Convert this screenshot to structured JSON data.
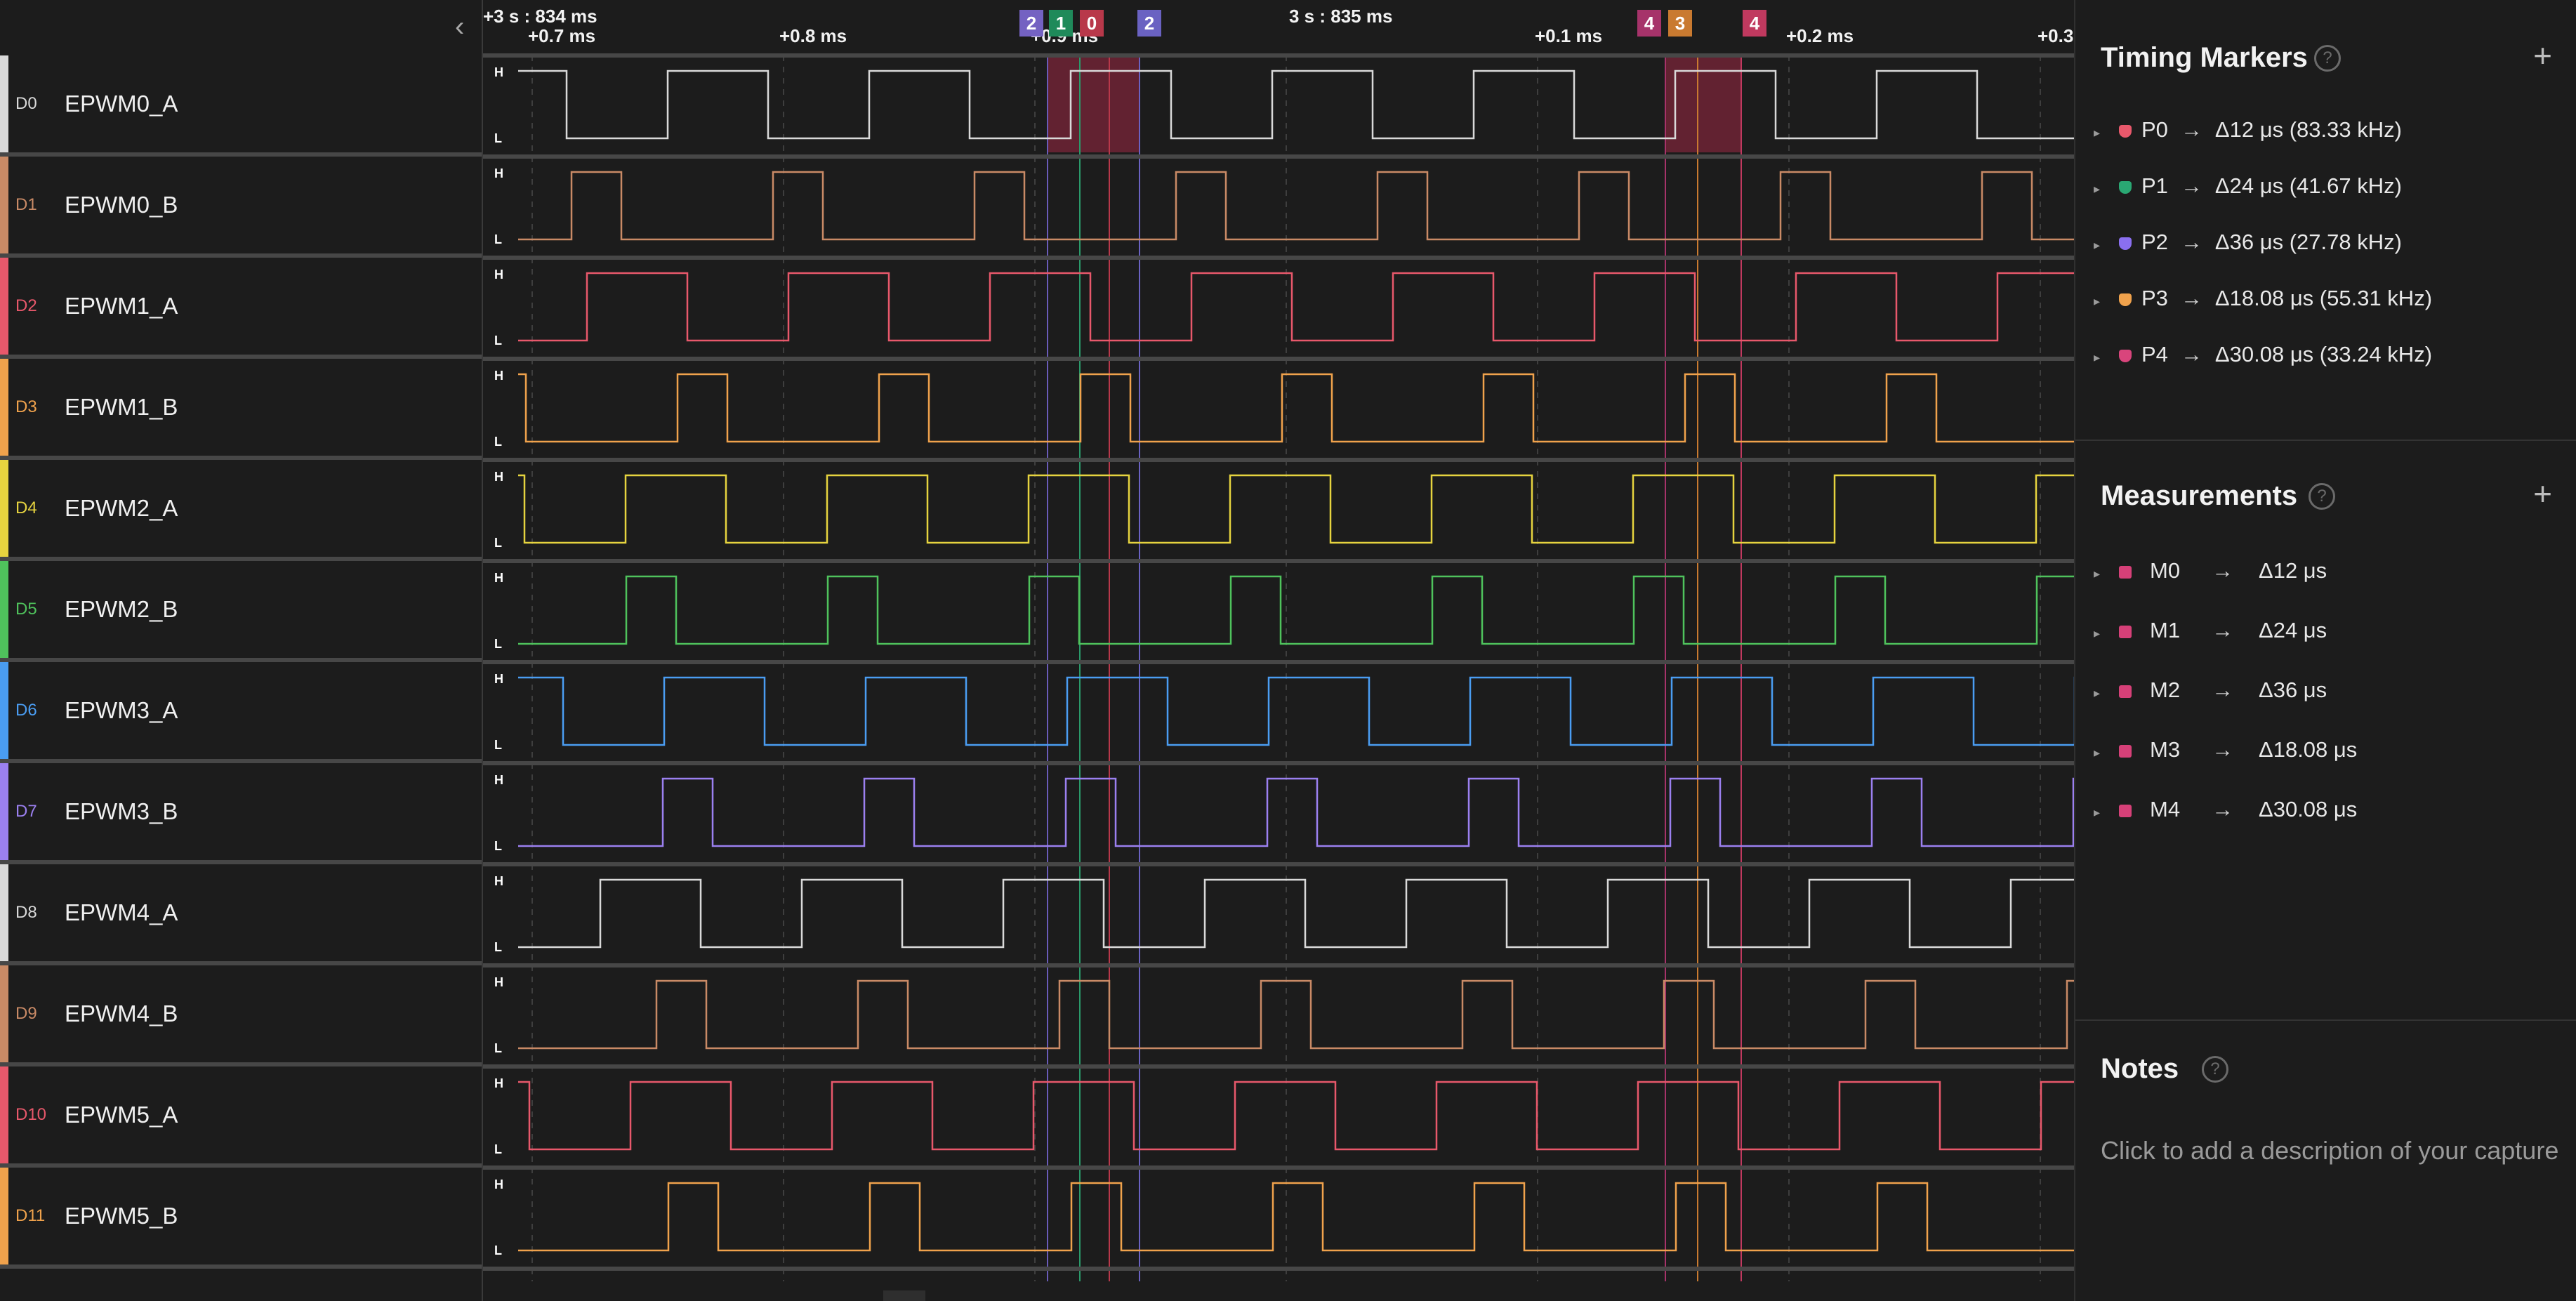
{
  "channels": [
    {
      "id": "D0",
      "name": "EPWM0_A",
      "color": "#d9d9d9",
      "period": 287,
      "high": 143,
      "phase": -24
    },
    {
      "id": "D1",
      "name": "EPWM0_B",
      "color": "#c98a66",
      "period": 287,
      "high": 71,
      "phase": 126
    },
    {
      "id": "D2",
      "name": "EPWM1_A",
      "color": "#e8586b",
      "period": 287,
      "high": 143,
      "phase": -139
    },
    {
      "id": "D3",
      "name": "EPWM1_B",
      "color": "#f0a24c",
      "period": 287,
      "high": 71,
      "phase": -10
    },
    {
      "id": "D4",
      "name": "EPWM2_A",
      "color": "#e6d33f",
      "period": 287,
      "high": 143,
      "phase": -84
    },
    {
      "id": "D5",
      "name": "EPWM2_B",
      "color": "#4fc25c",
      "period": 287,
      "high": 71,
      "phase": -83
    },
    {
      "id": "D6",
      "name": "EPWM3_A",
      "color": "#4a9df2",
      "period": 287,
      "high": 143,
      "phase": -29
    },
    {
      "id": "D7",
      "name": "EPWM3_B",
      "color": "#9b80f0",
      "period": 287,
      "high": 71,
      "phase": -31
    },
    {
      "id": "D8",
      "name": "EPWM4_A",
      "color": "#d9d9d9",
      "period": 287,
      "high": 143,
      "phase": -120
    },
    {
      "id": "D9",
      "name": "EPWM4_B",
      "color": "#c98a66",
      "period": 287,
      "high": 71,
      "phase": -40
    },
    {
      "id": "D10",
      "name": "EPWM5_A",
      "color": "#e8586b",
      "period": 287,
      "high": 143,
      "phase": -77
    },
    {
      "id": "D11",
      "name": "EPWM5_B",
      "color": "#f0a24c",
      "period": 287,
      "high": 71,
      "phase": -23
    }
  ],
  "levels": {
    "high": "H",
    "low": "L"
  },
  "ruler": {
    "abs_labels": [
      "+3 s : 834 ms",
      "3 s : 835 ms"
    ],
    "rel_labels": [
      "+0.7 ms",
      "+0.8 ms",
      "+0.9 ms",
      "+0.1 ms",
      "+0.2 ms",
      "+0.3"
    ]
  },
  "marker_flags": [
    {
      "label": "2",
      "color": "#7462c2"
    },
    {
      "label": "1",
      "color": "#1f8a5a"
    },
    {
      "label": "0",
      "color": "#b8384a"
    },
    {
      "label": "2",
      "color": "#6a62c2"
    },
    {
      "label": "4",
      "color": "#a6336a"
    },
    {
      "label": "3",
      "color": "#c97a30"
    },
    {
      "label": "4",
      "color": "#c0395f"
    }
  ],
  "timing_markers": {
    "title": "Timing Markers",
    "items": [
      {
        "label": "P0",
        "value": "Δ12 μs (83.33 kHz)",
        "color": "#e8586b"
      },
      {
        "label": "P1",
        "value": "Δ24 μs (41.67 kHz)",
        "color": "#2aa873"
      },
      {
        "label": "P2",
        "value": "Δ36 μs (27.78 kHz)",
        "color": "#8a6ff0"
      },
      {
        "label": "P3",
        "value": "Δ18.08 μs (55.31 kHz)",
        "color": "#f0a24c"
      },
      {
        "label": "P4",
        "value": "Δ30.08 μs (33.24 kHz)",
        "color": "#d9457c"
      }
    ]
  },
  "measurements": {
    "title": "Measurements",
    "items": [
      {
        "label": "M0",
        "value": "Δ12 μs",
        "color": "#d64078"
      },
      {
        "label": "M1",
        "value": "Δ24 μs",
        "color": "#d64078"
      },
      {
        "label": "M2",
        "value": "Δ36 μs",
        "color": "#d64078"
      },
      {
        "label": "M3",
        "value": "Δ18.08 μs",
        "color": "#d64078"
      },
      {
        "label": "M4",
        "value": "Δ30.08 μs",
        "color": "#d64078"
      }
    ]
  },
  "notes": {
    "title": "Notes",
    "placeholder": "Click to add a description of your capture"
  },
  "icons": {
    "help": "?",
    "plus": "+",
    "back": "‹",
    "expand": "▸",
    "arrow": "→"
  }
}
